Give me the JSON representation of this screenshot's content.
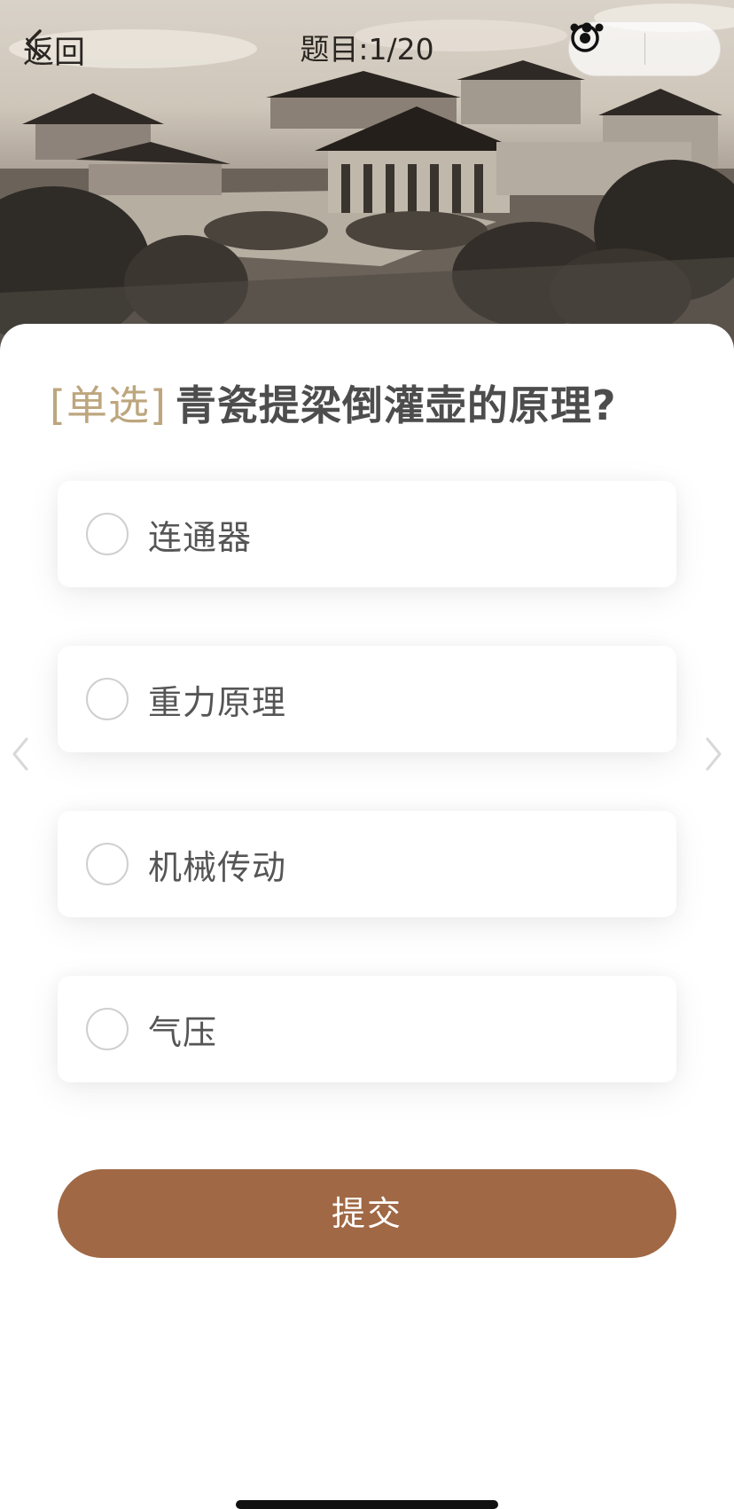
{
  "nav": {
    "back_label": "返回",
    "title": "题目:1/20"
  },
  "question": {
    "type_tag": "[单选]",
    "text": "青瓷提梁倒灌壶的原理?"
  },
  "options": [
    {
      "label": "连通器"
    },
    {
      "label": "重力原理"
    },
    {
      "label": "机械传动"
    },
    {
      "label": "气压"
    }
  ],
  "submit_label": "提交",
  "icons": {
    "back": "chevron-left-icon",
    "more": "more-dots-icon",
    "close": "target-circle-icon",
    "prev": "chevron-left-icon",
    "next": "chevron-right-icon"
  },
  "colors": {
    "accent": "#a06844",
    "tag": "#bda67e",
    "text": "#4d4d4d"
  }
}
